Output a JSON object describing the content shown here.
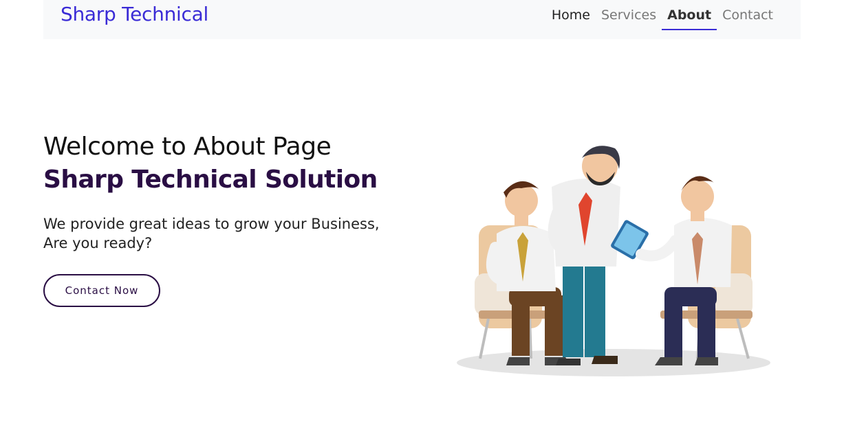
{
  "navbar": {
    "brand": "Sharp Technical",
    "links": [
      {
        "label": "Home"
      },
      {
        "label": "Services"
      },
      {
        "label": "About"
      },
      {
        "label": "Contact"
      }
    ],
    "active": "About"
  },
  "hero": {
    "title": "Welcome to About Page",
    "subtitle": "Sharp Technical Solution",
    "tagline": "We provide great ideas to grow your Business, Are you ready?",
    "cta_label": "Contact Now"
  },
  "illustration": {
    "icon": "business-meeting-illustration"
  },
  "colors": {
    "brand": "#3a2bd6",
    "heading_dark": "#2a0e44",
    "navbar_bg": "#f8f9fa"
  }
}
